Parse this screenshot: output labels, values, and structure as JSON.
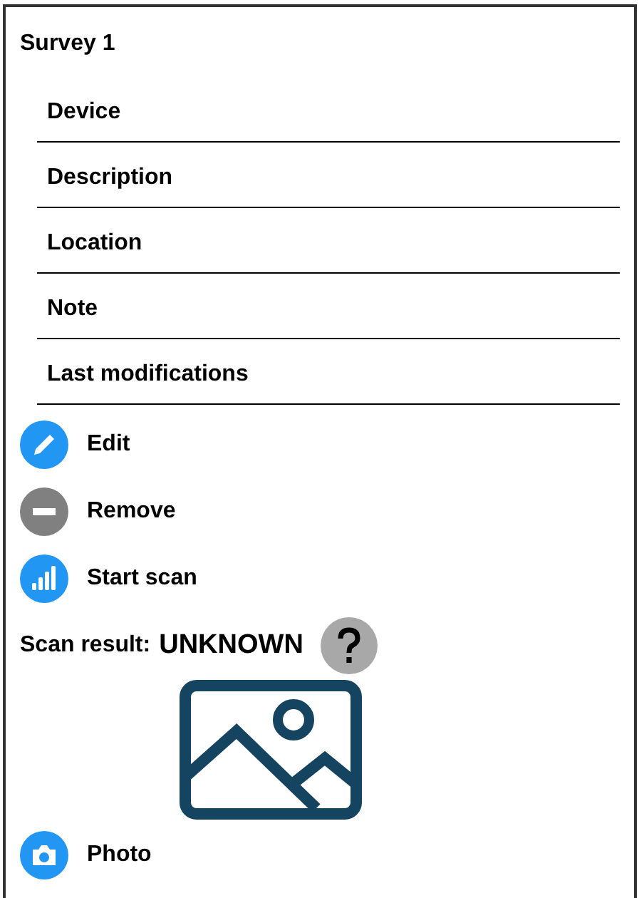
{
  "title": "Survey 1",
  "fields": [
    {
      "label": "Device"
    },
    {
      "label": "Description"
    },
    {
      "label": "Location"
    },
    {
      "label": "Note"
    },
    {
      "label": "Last modifications"
    }
  ],
  "actions": [
    {
      "kind": "edit",
      "label": "Edit"
    },
    {
      "kind": "remove",
      "label": "Remove"
    },
    {
      "kind": "scan",
      "label": "Start scan"
    }
  ],
  "scan_result": {
    "label": "Scan result:",
    "value": "UNKNOWN"
  },
  "photo_action": {
    "kind": "photo",
    "label": "Photo"
  }
}
